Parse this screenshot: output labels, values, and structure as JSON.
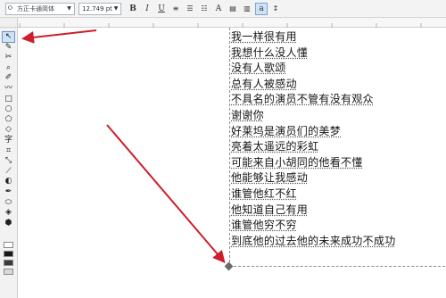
{
  "property_bar": {
    "font_name": "方正卡通简体",
    "font_size": "12.749 pt",
    "font_icon": "truetype-icon",
    "buttons": [
      {
        "label": "B",
        "name": "bold-button",
        "style": "bold",
        "active": false
      },
      {
        "label": "I",
        "name": "italic-button",
        "style": "ital",
        "active": false
      },
      {
        "label": "U",
        "name": "underline-button",
        "style": "under",
        "active": false
      },
      {
        "label": "≡",
        "name": "align-button",
        "style": "sym",
        "active": false
      },
      {
        "label": "☰",
        "name": "bullet-list-button",
        "style": "sym",
        "active": false
      },
      {
        "label": "☷",
        "name": "drop-cap-button",
        "style": "sym",
        "active": false
      },
      {
        "label": "A",
        "name": "character-format-button",
        "style": "",
        "active": false
      },
      {
        "label": "▤",
        "name": "paragraph-format-button",
        "style": "sym",
        "active": false
      },
      {
        "label": "▥",
        "name": "text-frame-button",
        "style": "sym",
        "active": false
      },
      {
        "label": "a",
        "name": "horizontal-text-button",
        "style": "",
        "active": true
      },
      {
        "label": "↕",
        "name": "vertical-text-button",
        "style": "sym",
        "active": false
      }
    ]
  },
  "toolbox": {
    "tools": [
      {
        "icon": "↖",
        "name": "pick-tool-icon",
        "active": true
      },
      {
        "icon": "✎",
        "name": "shape-tool-icon",
        "active": false
      },
      {
        "icon": "✂",
        "name": "crop-tool-icon",
        "active": false
      },
      {
        "icon": "⌕",
        "name": "zoom-tool-icon",
        "active": false
      },
      {
        "icon": "✐",
        "name": "freehand-tool-icon",
        "active": false
      },
      {
        "icon": "〰",
        "name": "artistic-media-tool-icon",
        "active": false
      },
      {
        "icon": "□",
        "name": "rectangle-tool-icon",
        "active": false
      },
      {
        "icon": "○",
        "name": "ellipse-tool-icon",
        "active": false
      },
      {
        "icon": "⬠",
        "name": "polygon-tool-icon",
        "active": false
      },
      {
        "icon": "◇",
        "name": "basic-shapes-tool-icon",
        "active": false
      },
      {
        "icon": "字",
        "name": "text-tool-icon",
        "active": false
      },
      {
        "icon": "⌗",
        "name": "table-tool-icon",
        "active": false
      },
      {
        "icon": "⤡",
        "name": "dimension-tool-icon",
        "active": false
      },
      {
        "icon": "⟋",
        "name": "connector-tool-icon",
        "active": false
      },
      {
        "icon": "◐",
        "name": "interactive-effects-tool-icon",
        "active": false
      },
      {
        "icon": "✒",
        "name": "eyedropper-tool-icon",
        "active": false
      },
      {
        "icon": "⬭",
        "name": "outline-tool-icon",
        "active": false
      },
      {
        "icon": "◈",
        "name": "fill-tool-icon",
        "active": false
      },
      {
        "icon": "⬢",
        "name": "smart-fill-tool-icon",
        "active": false
      }
    ],
    "swatches": [
      "#ffffff",
      "#1a1a1a",
      "#3a3a3a",
      "#d8d8d8"
    ]
  },
  "canvas": {
    "text_lines": [
      "我一样很有用",
      "我想什么没人懂",
      "没有人歌颂",
      "总有人被感动",
      "不具名的演员不管有没有观众",
      "谢谢你",
      "好莱坞是演员们的美梦",
      "亮着太遥远的彩虹",
      "可能来自小胡同的他看不懂",
      "他能够让我感动",
      "谁管他红不红",
      "他知道自己有用",
      "谁管他穷不穷",
      "到底他的过去他的未来成功不成功"
    ]
  },
  "colors": {
    "annotation_arrow": "#cc1f2b",
    "active_tool_bg": "#cfe3f7"
  }
}
